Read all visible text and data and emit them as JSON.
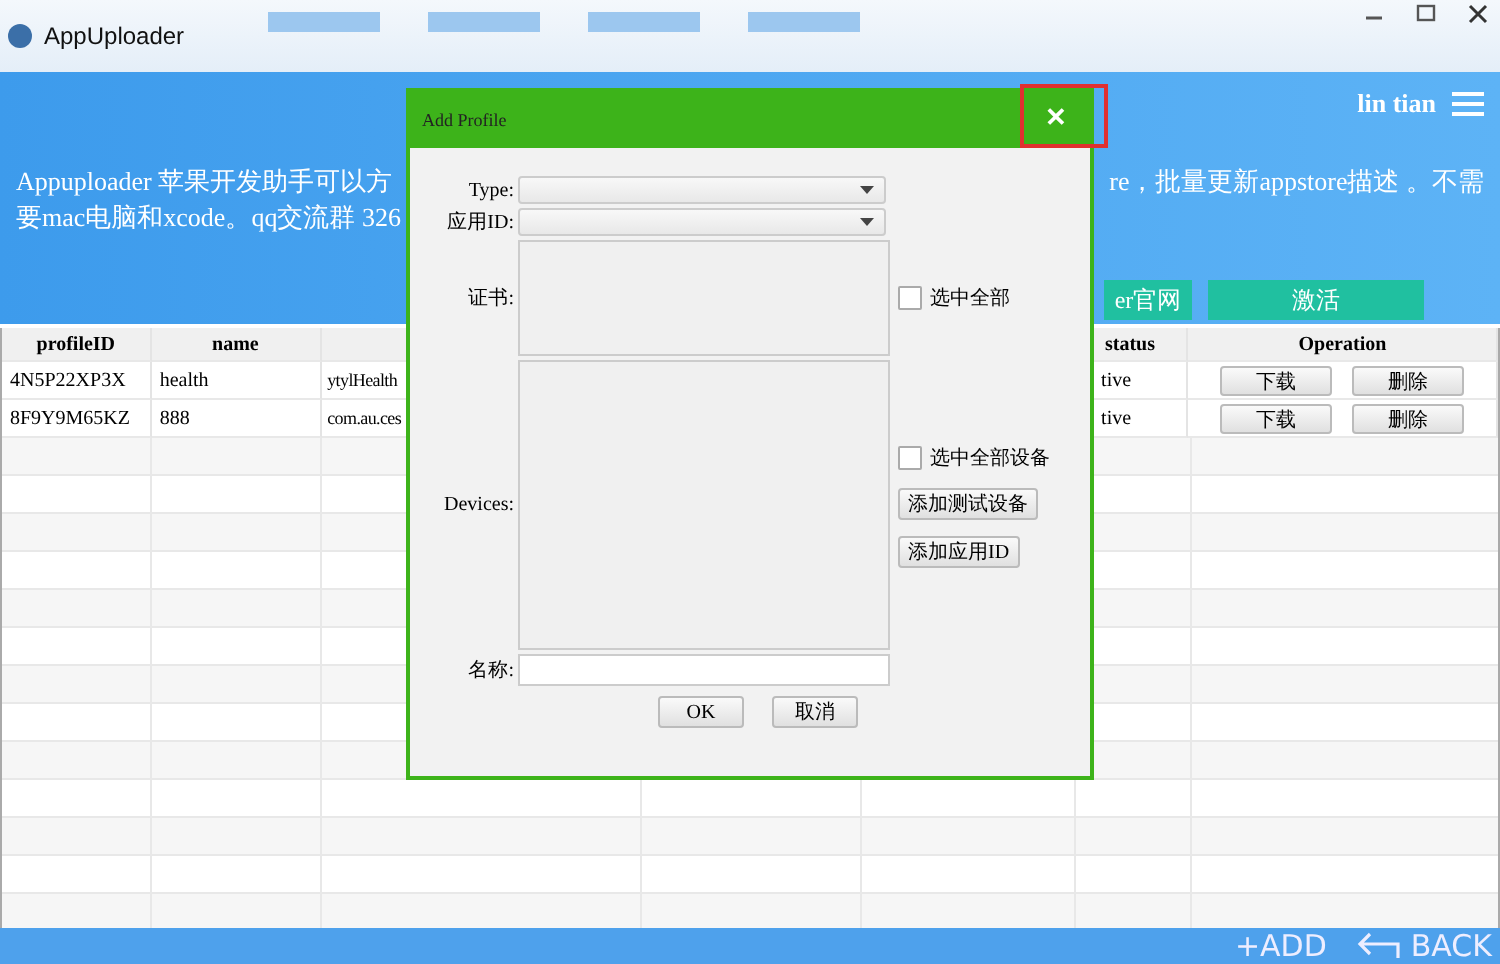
{
  "window": {
    "title": "AppUploader"
  },
  "header": {
    "user": "lin tian",
    "description_left": [
      "Appuploader 苹果开发助手可以方",
      "要mac电脑和xcode。qq交流群 326"
    ],
    "description_right": "re，批量更新appstore描述 。不需",
    "buttons": [
      "er官网",
      "激活"
    ]
  },
  "table": {
    "columns": [
      {
        "label": "profileID"
      },
      {
        "label": "name"
      },
      {
        "label": "status"
      },
      {
        "label": "Operation"
      }
    ],
    "rows": [
      {
        "profile_id": "4N5P22XP3X",
        "name": "health",
        "column_3": "ytylHealth",
        "status": "tive",
        "actions": [
          "下载",
          "删除"
        ]
      },
      {
        "profile_id": "8F9Y9M65KZ",
        "name": "888",
        "column_3": "com.au.ces",
        "status": "tive",
        "actions": [
          "下载",
          "删除"
        ]
      }
    ]
  },
  "dialog": {
    "title": "Add Profile",
    "close": "✕",
    "type_label": "Type:",
    "appid_label": "应用ID:",
    "cert_label": "证书:",
    "select_all_certs": {
      "label": "选中全部",
      "checked": false
    },
    "devices_label": "Devices:",
    "select_all_devices": {
      "label": "选中全部设备",
      "checked": false
    },
    "add_device": "添加测试设备",
    "add_appid": "添加应用ID",
    "name_label": "名称:",
    "ok": "OK",
    "cancel": "取消"
  },
  "bottom_bar": {
    "add": "+ADD",
    "back": "BACK"
  }
}
